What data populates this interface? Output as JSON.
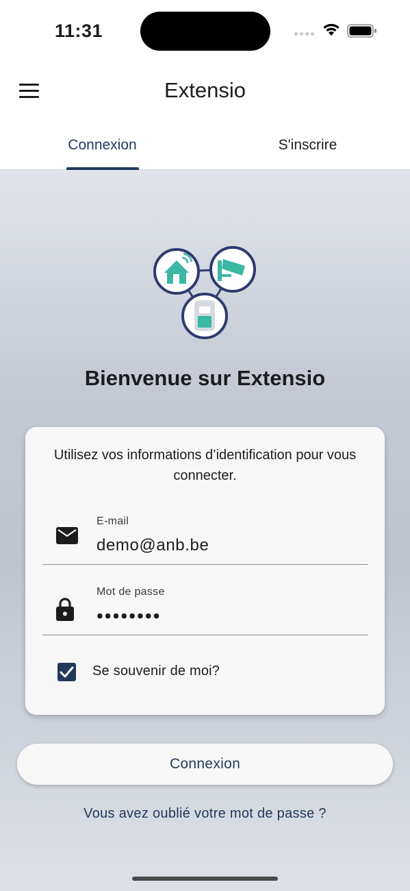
{
  "status_bar": {
    "time": "11:31"
  },
  "header": {
    "title": "Extensio",
    "menu_icon": "hamburger-menu-icon"
  },
  "tabs": [
    {
      "label": "Connexion",
      "selected": true
    },
    {
      "label": "S'inscrire",
      "selected": false
    }
  ],
  "welcome": {
    "title": "Bienvenue sur Extensio",
    "logo_icon": "extensio-logo-icon"
  },
  "login_form": {
    "intro": "Utilisez vos informations d’identification pour vous connecter.",
    "email": {
      "label": "E-mail",
      "value": "demo@anb.be",
      "icon": "envelope-icon"
    },
    "password": {
      "label": "Mot de passe",
      "value": "••••••••",
      "icon": "lock-icon"
    },
    "remember_me": {
      "label": "Se souvenir de moi?",
      "checked": true
    }
  },
  "actions": {
    "login_label": "Connexion",
    "forgot_password": "Vous avez oublié votre mot de passe ?"
  },
  "colors": {
    "accent": "#23395b",
    "logo_teal": "#3bb7a4",
    "logo_ring": "#2e3a6e"
  }
}
